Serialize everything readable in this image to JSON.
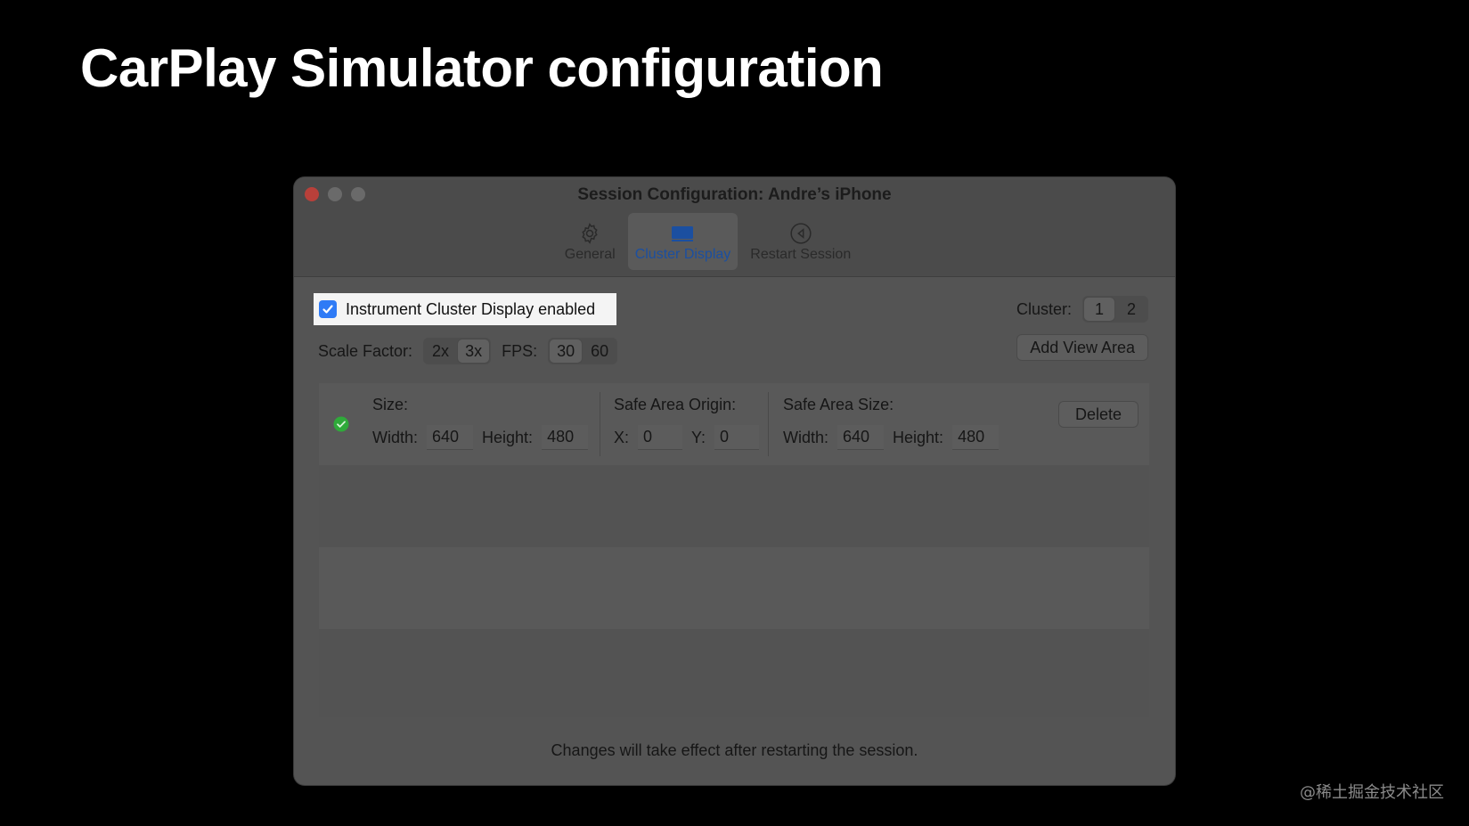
{
  "slide": {
    "title": "CarPlay Simulator configuration"
  },
  "watermark": "@稀土掘金技术社区",
  "window": {
    "title": "Session Configuration: Andre’s iPhone",
    "tabs": [
      {
        "label": "General",
        "icon": "gear-icon"
      },
      {
        "label": "Cluster Display",
        "icon": "display-icon",
        "active": true
      },
      {
        "label": "Restart Session",
        "icon": "restart-icon"
      }
    ]
  },
  "cluster": {
    "enabled_label": "Instrument Cluster Display enabled",
    "enabled": true,
    "cluster_label": "Cluster:",
    "cluster_options": [
      "1",
      "2"
    ],
    "cluster_selected": "1",
    "scale_label": "Scale Factor:",
    "scale_options": [
      "2x",
      "3x"
    ],
    "scale_selected": "3x",
    "fps_label": "FPS:",
    "fps_options": [
      "30",
      "60"
    ],
    "fps_selected": "30",
    "add_view_area": "Add View Area"
  },
  "view_area": {
    "status_color": "#2faa3a",
    "size_label": "Size:",
    "width_label": "Width:",
    "width": "640",
    "height_label": "Height:",
    "height": "480",
    "origin_label": "Safe Area Origin:",
    "x_label": "X:",
    "x": "0",
    "y_label": "Y:",
    "y": "0",
    "safe_size_label": "Safe Area Size:",
    "safe_width_label": "Width:",
    "safe_width": "640",
    "safe_height_label": "Height:",
    "safe_height": "480",
    "delete": "Delete"
  },
  "footer": "Changes will take effect after restarting the session.",
  "colors": {
    "accent": "#2f7bf6",
    "active_tab": "#1b4fa0",
    "close": "#b8403a"
  }
}
